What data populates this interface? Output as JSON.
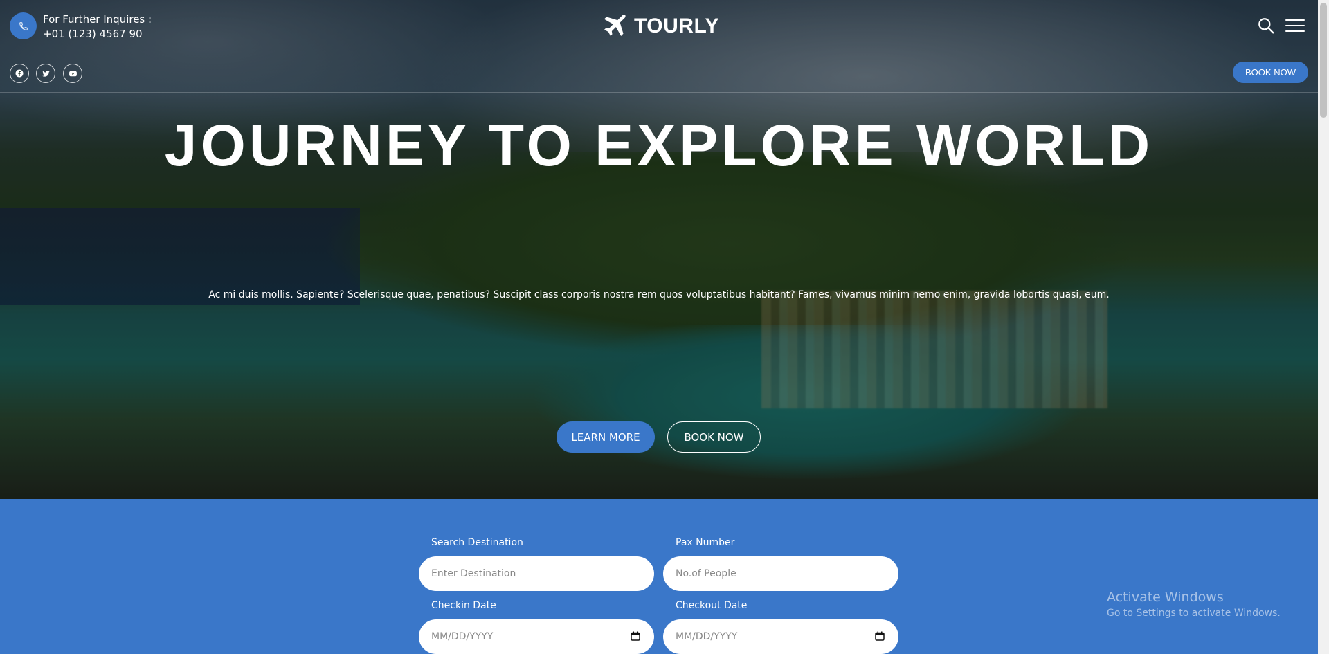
{
  "header": {
    "inquiry_label": "For Further Inquires :",
    "phone": "+01 (123) 4567 90",
    "brand": "TOURLY",
    "book_now_label": "BOOK NOW",
    "social_icons": [
      "facebook-icon",
      "twitter-icon",
      "youtube-icon"
    ]
  },
  "hero": {
    "headline": "JOURNEY TO EXPLORE WORLD",
    "description": "Ac mi duis mollis. Sapiente? Scelerisque quae, penatibus? Suscipit class corporis nostra rem quos voluptatibus habitant? Fames, vivamus minim nemo enim, gravida lobortis quasi, eum.",
    "learn_more_label": "LEARN MORE",
    "book_now_label": "BOOK NOW"
  },
  "booking": {
    "destination_label": "Search Destination",
    "destination_placeholder": "Enter Destination",
    "pax_label": "Pax Number",
    "pax_placeholder": "No.of People",
    "checkin_label": "Checkin Date",
    "checkin_placeholder": "MM/DD/YYYY",
    "checkout_label": "Checkout Date",
    "checkout_placeholder": "MM/DD/YYYY"
  },
  "watermark": {
    "title": "Activate Windows",
    "subtitle": "Go to Settings to activate Windows."
  },
  "colors": {
    "accent": "#3a77c9",
    "text_on_dark": "#ffffff"
  }
}
